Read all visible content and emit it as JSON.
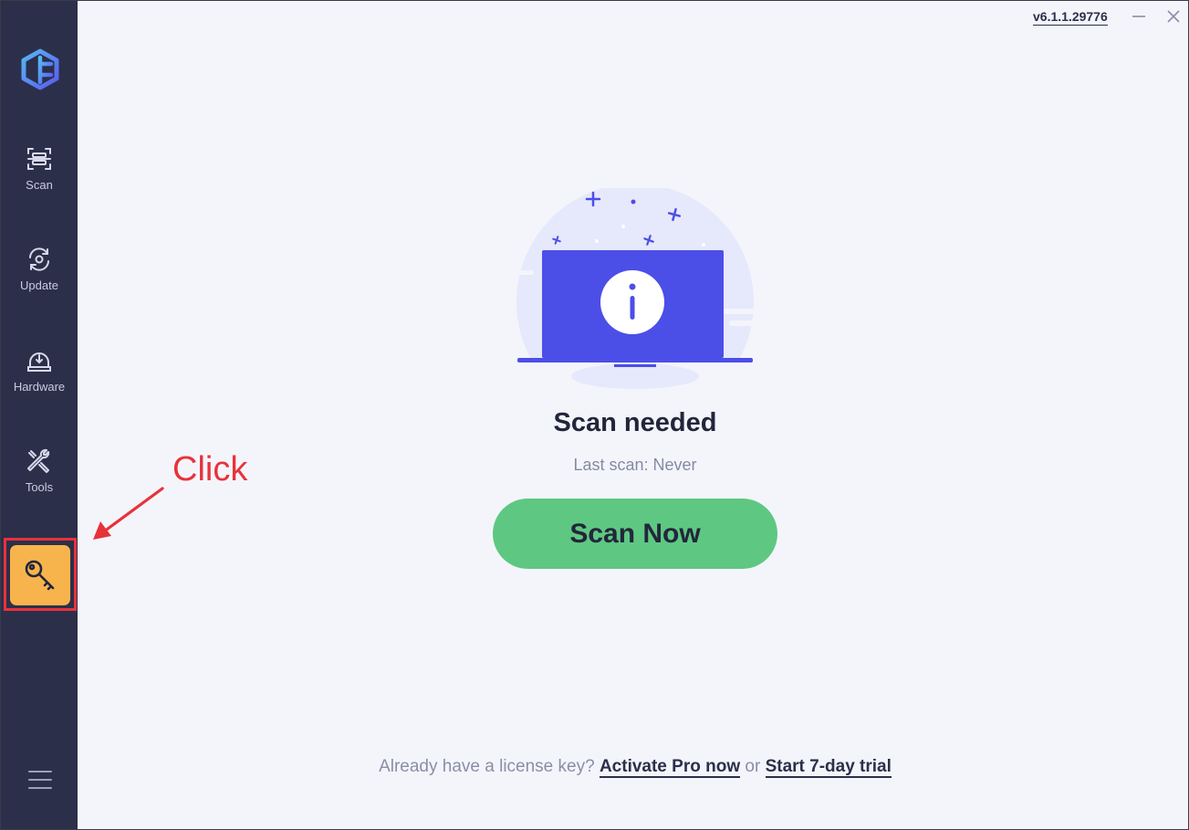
{
  "titlebar": {
    "version": "v6.1.1.29776",
    "minimize_icon": "minimize-icon",
    "close_icon": "close-icon"
  },
  "sidebar": {
    "logo_icon": "app-logo-icon",
    "items": [
      {
        "label": "Scan",
        "icon": "scan-icon"
      },
      {
        "label": "Update",
        "icon": "update-icon"
      },
      {
        "label": "Hardware",
        "icon": "hardware-icon"
      },
      {
        "label": "Tools",
        "icon": "tools-icon"
      }
    ],
    "license_icon": "key-icon",
    "menu_icon": "hamburger-menu-icon"
  },
  "main": {
    "status_title": "Scan needed",
    "last_scan": "Last scan: Never",
    "scan_button_label": "Scan Now",
    "footer": {
      "prefix": "Already have a license key?",
      "activate_link": "Activate Pro now",
      "or": "or",
      "trial_link": "Start 7-day trial"
    }
  },
  "annotation": {
    "text": "Click",
    "color": "#e8323a"
  },
  "colors": {
    "sidebar_bg": "#2c2f4a",
    "license_button": "#f8b44c",
    "scan_button": "#5ec882",
    "laptop_screen": "#4c4ee8"
  }
}
